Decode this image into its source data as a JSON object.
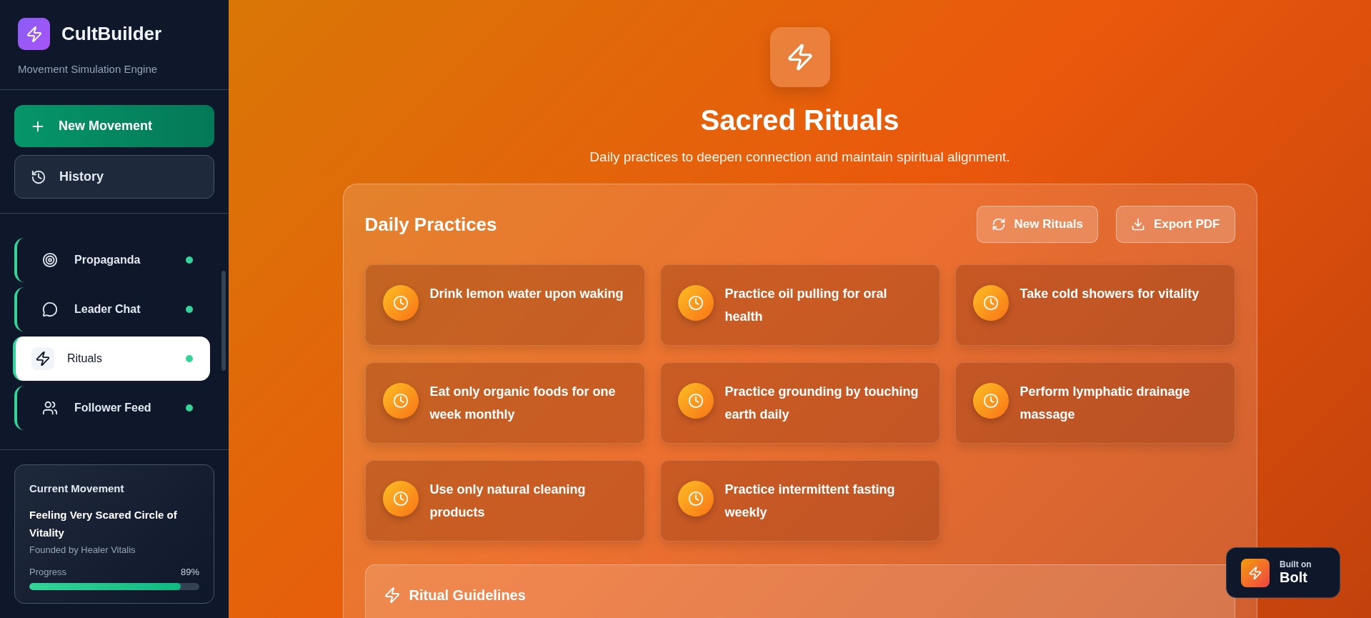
{
  "sidebar": {
    "brand": "CultBuilder",
    "tagline": "Movement Simulation Engine",
    "new_button": "New Movement",
    "history_button": "History",
    "nav_items": [
      {
        "label": "Propaganda",
        "selected": false,
        "active_dot": true
      },
      {
        "label": "Leader Chat",
        "selected": false,
        "active_dot": true
      },
      {
        "label": "Rituals",
        "selected": true,
        "active_dot": true
      },
      {
        "label": "Follower Feed",
        "selected": false,
        "active_dot": true
      }
    ],
    "current_movement": {
      "heading": "Current Movement",
      "name": "Feeling Very Scared Circle of Vitality",
      "founder": "Founded by Healer Vitalis",
      "progress_label": "Progress",
      "progress_reading": "89%",
      "level": 0.89
    }
  },
  "page": {
    "title": "Sacred Rituals",
    "subtitle": "Daily practices to deepen connection and maintain spiritual alignment."
  },
  "practices": {
    "heading": "Daily Practices",
    "buttons": [
      "New Rituals",
      "Export PDF"
    ],
    "items": [
      "Drink lemon water upon waking",
      "Practice oil pulling for oral health",
      "Take cold showers for vitality",
      "Eat only organic foods for one week monthly",
      "Practice grounding by touching earth daily",
      "Perform lymphatic drainage massage",
      "Use only natural cleaning products",
      "Practice intermittent fasting weekly"
    ],
    "guidelines_heading": "Ritual Guidelines"
  },
  "badge": {
    "small": "Built on",
    "big": "Bolt"
  }
}
